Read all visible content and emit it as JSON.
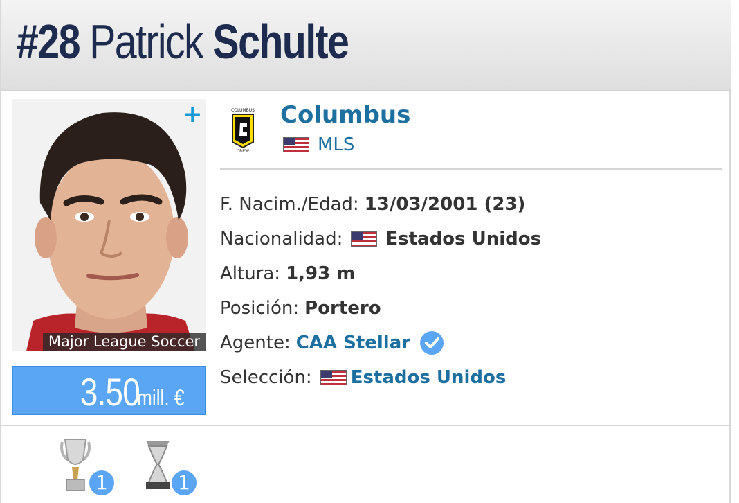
{
  "header": {
    "number": "#28",
    "first_name": "Patrick",
    "last_name": "Schulte"
  },
  "photo": {
    "caption": "Major League Soccer",
    "add_icon": "+"
  },
  "market_value": {
    "amount": "3.50",
    "unit": "mill. €"
  },
  "club": {
    "name": "Columbus",
    "league": "MLS",
    "logo_icon": "columbus-crew-logo"
  },
  "details": {
    "birth_label": "F. Nacim./Edad:",
    "birth_value": "13/03/2001 (23)",
    "nationality_label": "Nacionalidad:",
    "nationality_value": "Estados Unidos",
    "height_label": "Altura:",
    "height_value": "1,93 m",
    "position_label": "Posición:",
    "position_value": "Portero",
    "agent_label": "Agente:",
    "agent_value": "CAA Stellar",
    "national_team_label": "Selección:",
    "national_team_value": "Estados Unidos"
  },
  "trophies": [
    {
      "icon": "mls-cup-trophy-icon",
      "count": "1"
    },
    {
      "icon": "cup-trophy-icon",
      "count": "1"
    }
  ],
  "colors": {
    "accent_blue": "#5aa6f5",
    "link_blue": "#1d6fa0",
    "title_navy": "#1d2b4f"
  }
}
